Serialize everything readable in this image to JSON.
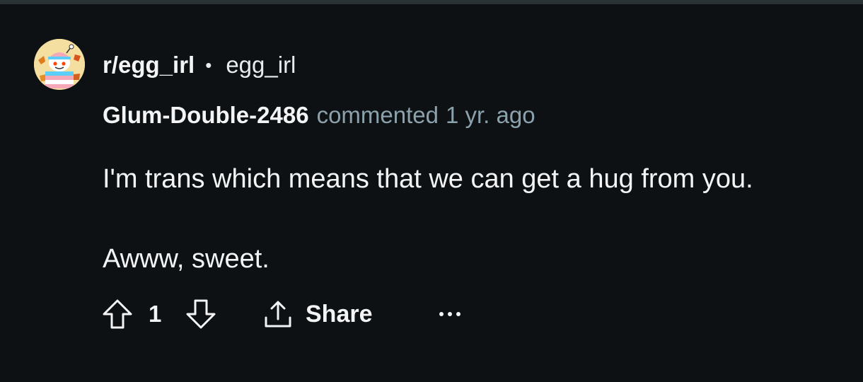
{
  "post": {
    "community_link": "r/egg_irl",
    "separator": "•",
    "community_name": "egg_irl",
    "author": "Glum-Double-2486",
    "action": "commented",
    "time": "1 yr. ago",
    "body_lines": [
      "I'm trans which means that we can get a hug from you.",
      "Awww, sweet."
    ]
  },
  "actions": {
    "score": "1",
    "share_label": "Share"
  },
  "icons": {
    "avatar": "snoo-avatar-icon",
    "upvote": "upvote-arrow-icon",
    "downvote": "downvote-arrow-icon",
    "share": "share-icon",
    "more": "ellipsis-icon"
  },
  "colors": {
    "background": "#0e1113",
    "text_primary": "#f2f4f5",
    "text_secondary": "#8ba2ad",
    "divider": "#2a3236"
  }
}
